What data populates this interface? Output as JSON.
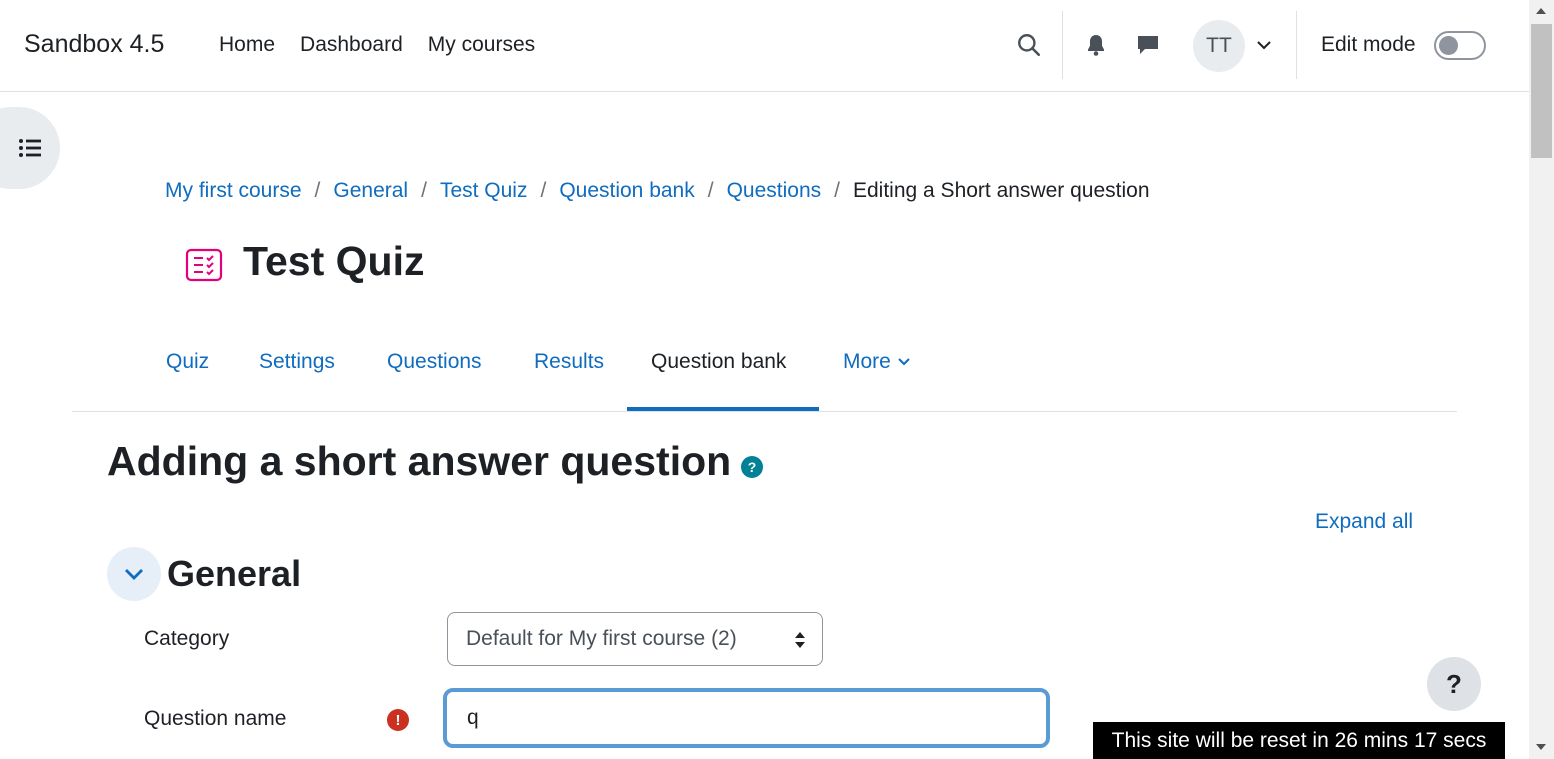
{
  "header": {
    "brand": "Sandbox 4.5",
    "nav": [
      "Home",
      "Dashboard",
      "My courses"
    ],
    "avatar_initials": "TT",
    "edit_mode_label": "Edit mode"
  },
  "breadcrumb": {
    "items": [
      "My first course",
      "General",
      "Test Quiz",
      "Question bank",
      "Questions"
    ],
    "current": "Editing a Short answer question",
    "separator": "/"
  },
  "page": {
    "title": "Test Quiz"
  },
  "tabs": [
    "Quiz",
    "Settings",
    "Questions",
    "Results",
    "Question bank",
    "More"
  ],
  "active_tab": "Question bank",
  "form": {
    "title": "Adding a short answer question",
    "help_symbol": "?",
    "expand_all": "Expand all",
    "section_title": "General",
    "category_label": "Category",
    "category_value": "Default for My first course (2)",
    "question_name_label": "Question name",
    "required_symbol": "!",
    "question_name_value": "q"
  },
  "help_button": "?",
  "reset_banner": "This site will be reset in 26 mins 17 secs",
  "colors": {
    "link": "#0f6cbf",
    "active_underline": "#0f6cbf",
    "help_dot": "#008196",
    "required": "#ca3120",
    "focus_border": "#5b9bd5"
  }
}
